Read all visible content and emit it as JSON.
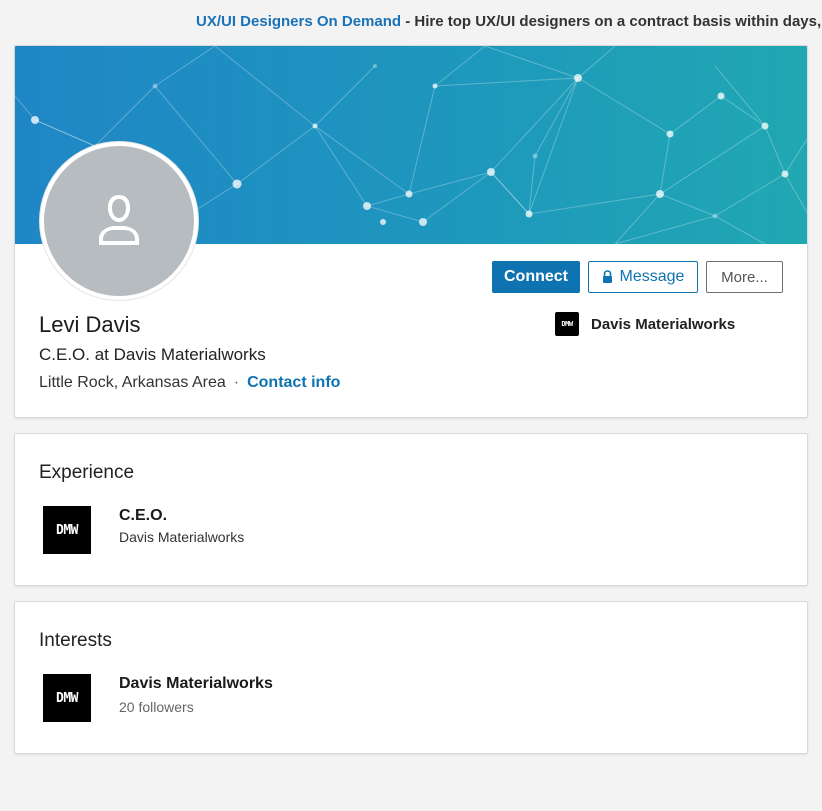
{
  "ad": {
    "link_text": "UX/UI Designers On Demand",
    "text": " - Hire top UX/UI designers on a contract basis within days,"
  },
  "profile": {
    "name": "Levi Davis",
    "headline": "C.E.O. at Davis Materialworks",
    "location": "Little Rock, Arkansas Area",
    "separator": "·",
    "contact_info_label": "Contact info",
    "current_company": "Davis Materialworks",
    "company_logo_text": "DMW"
  },
  "actions": {
    "connect_label": "Connect",
    "message_label": "Message",
    "more_label": "More..."
  },
  "experience": {
    "section_title": "Experience",
    "items": [
      {
        "title": "C.E.O.",
        "company": "Davis Materialworks",
        "logo_text": "DMW"
      }
    ]
  },
  "interests": {
    "section_title": "Interests",
    "items": [
      {
        "name": "Davis Materialworks",
        "followers": "20 followers",
        "logo_text": "DMW"
      }
    ]
  },
  "icons": {
    "avatar": "person-silhouette-icon",
    "message": "lock-icon"
  },
  "colors": {
    "primary": "#0f73b1",
    "cover_start": "#1f86c6",
    "cover_end": "#20a8b2",
    "avatar_bg": "#b6bcc0"
  }
}
